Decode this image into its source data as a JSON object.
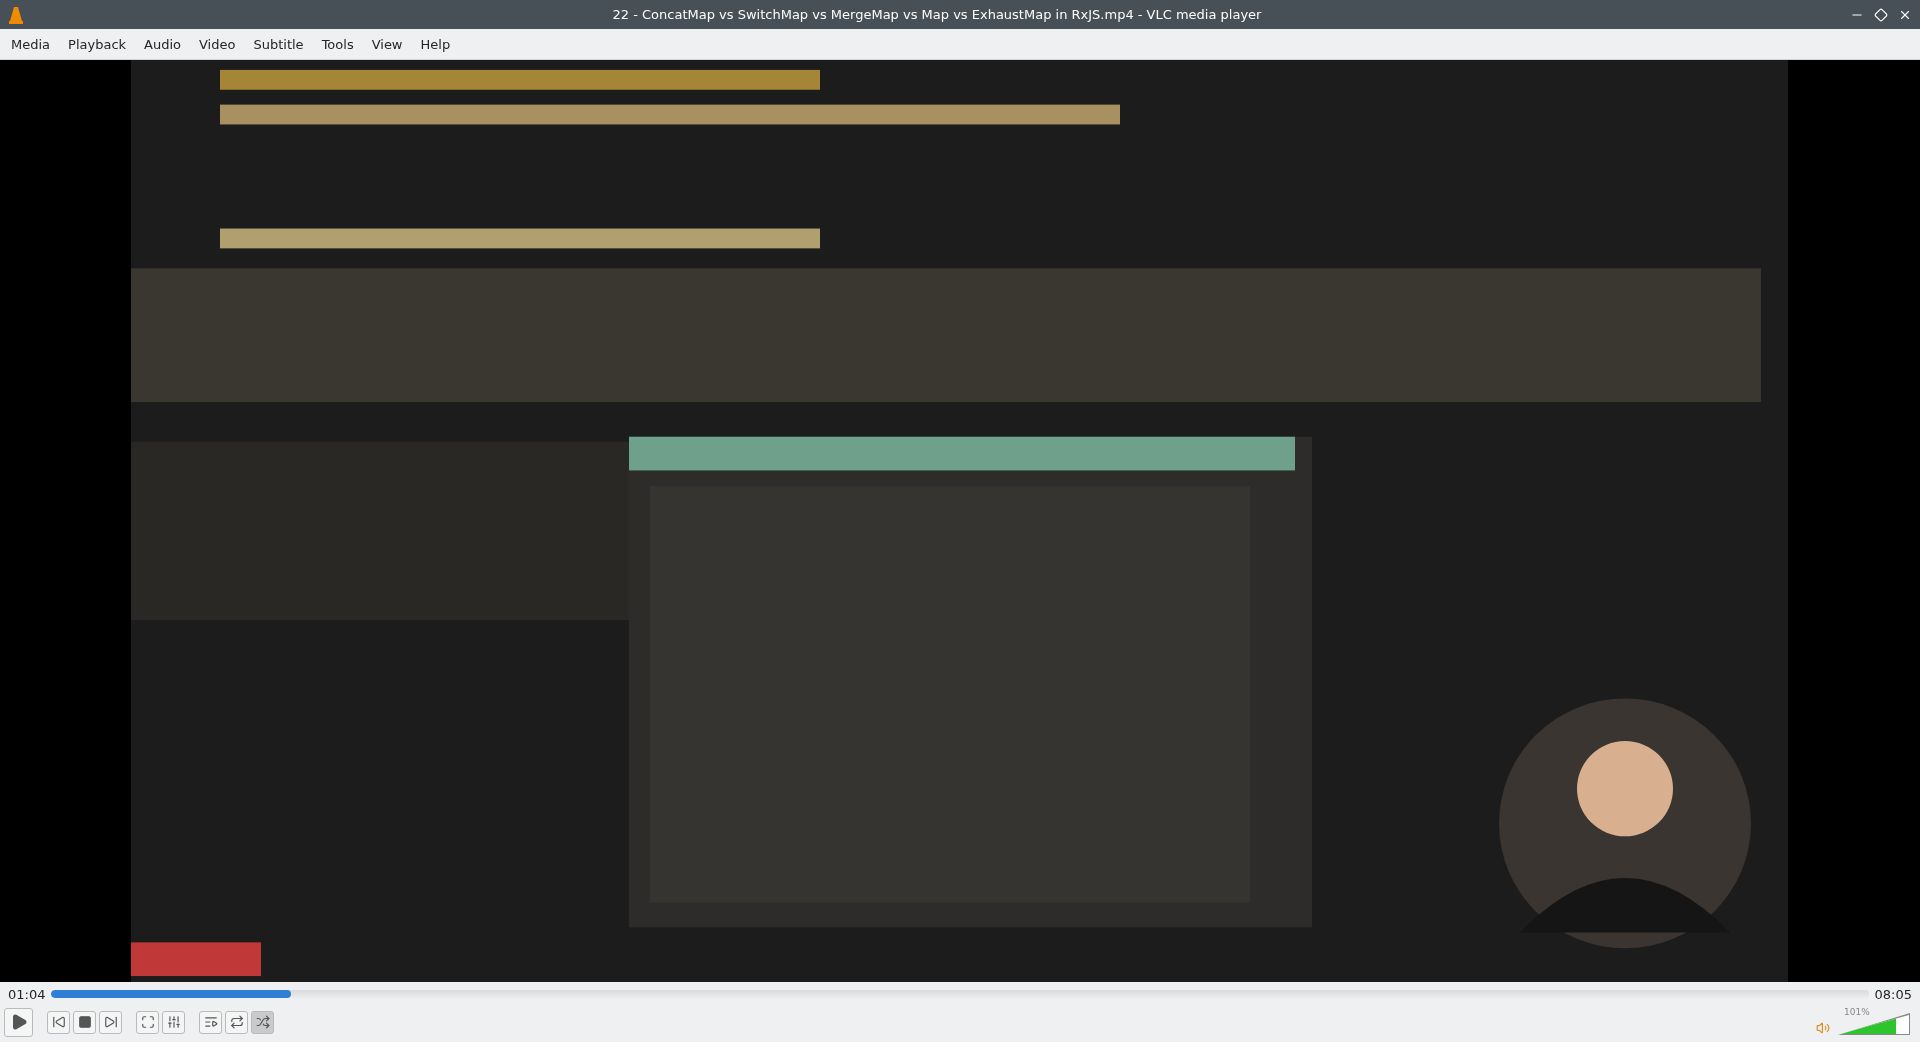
{
  "window": {
    "title": "22 - ConcatMap vs SwitchMap vs MergeMap vs Map vs ExhaustMap in RxJS.mp4 - VLC media player"
  },
  "menu": [
    "Media",
    "Playback",
    "Audio",
    "Video",
    "Subtitle",
    "Tools",
    "View",
    "Help"
  ],
  "video": {
    "kind": "picture"
  },
  "seek": {
    "elapsed": "01:04",
    "total": "08:05",
    "level": 0.132
  },
  "controls": [
    {
      "kind": "play",
      "on": false
    },
    {
      "kind": "previous",
      "on": false
    },
    {
      "kind": "stop",
      "on": false
    },
    {
      "kind": "next",
      "on": false
    },
    {
      "kind": "fullscreen",
      "on": false
    },
    {
      "kind": "settings",
      "on": false
    },
    {
      "kind": "playlist",
      "on": false
    },
    {
      "kind": "loop",
      "on": false
    },
    {
      "kind": "shuffle",
      "on": true
    }
  ],
  "volume": {
    "reading": "101%",
    "level": 0.8
  }
}
